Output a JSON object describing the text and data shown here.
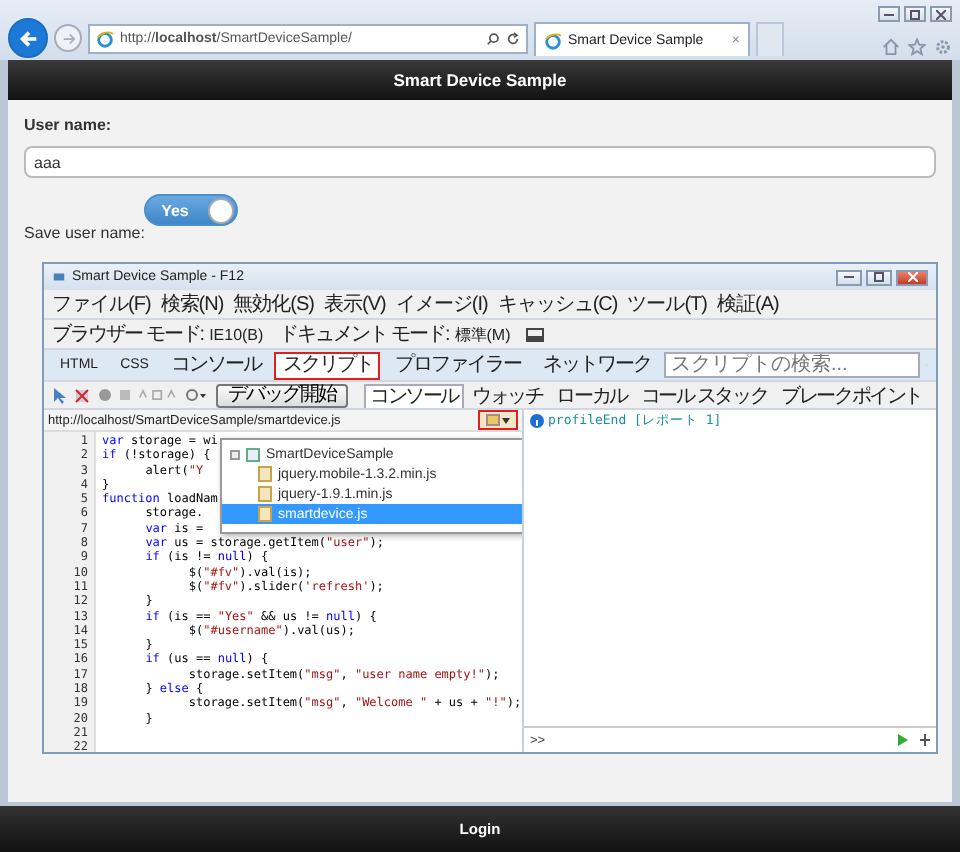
{
  "browser": {
    "address": "http://**localhost**/SmartDeviceSample/",
    "tab": {
      "title": "Smart Device Sample",
      "close": "×"
    }
  },
  "app": {
    "title": "Smart Device Sample",
    "footer_button": "Login"
  },
  "form": {
    "user_label": "User name:",
    "user_value": "aaa",
    "save_label": "Save user name:",
    "toggle": {
      "label": "Yes",
      "on": true
    }
  },
  "devtools": {
    "title": "Smart Device Sample - F12",
    "menu": [
      "ファイル(F)",
      "検索(N)",
      "無効化(S)",
      "表示(V)",
      "イメージ(I)",
      "キャッシュ(C)",
      "ツール(T)",
      "検証(A)"
    ],
    "modes": [
      {
        "label": "ブラウザー モード:",
        "value": "IE10(B)"
      },
      {
        "label": "ドキュメント モード:",
        "value": "標準(M)"
      }
    ],
    "tabs": [
      {
        "label": "HTML",
        "selected": false
      },
      {
        "label": "CSS",
        "selected": false
      },
      {
        "label": "コンソール",
        "selected": false
      },
      {
        "label": "スクリプト",
        "selected": true
      },
      {
        "label": "プロファイラー",
        "selected": false
      },
      {
        "label": "ネットワーク",
        "selected": false
      }
    ],
    "search": {
      "placeholder": "スクリプトの検索..."
    },
    "debug_button": "デバッグ開始",
    "side_tabs": [
      {
        "label": "コンソール",
        "selected": true
      },
      {
        "label": "ウォッチ",
        "selected": false
      },
      {
        "label": "ローカル",
        "selected": false
      },
      {
        "label": "コール スタック",
        "selected": false
      },
      {
        "label": "ブレークポイント",
        "selected": false
      }
    ],
    "file_path": "http://localhost/SmartDeviceSample/smartdevice.js",
    "code": [
      {
        "n": "1",
        "tokens": [
          {
            "kind": "kw",
            "t": "var"
          },
          {
            "kind": "plain",
            "t": " storage = wi"
          }
        ]
      },
      {
        "n": "2",
        "tokens": [
          {
            "kind": "kw",
            "t": "if"
          },
          {
            "kind": "plain",
            "t": " (!storage) {"
          }
        ]
      },
      {
        "n": "3",
        "tokens": [
          {
            "kind": "plain",
            "t": "\talert("
          },
          {
            "kind": "str",
            "t": "\"Y"
          }
        ]
      },
      {
        "n": "4",
        "tokens": [
          {
            "kind": "plain",
            "t": "}"
          }
        ]
      },
      {
        "n": "5",
        "tokens": [
          {
            "kind": "kw",
            "t": "function"
          },
          {
            "kind": "plain",
            "t": " loadNam"
          }
        ]
      },
      {
        "n": "6",
        "tokens": [
          {
            "kind": "plain",
            "t": "\tstorage."
          }
        ]
      },
      {
        "n": "7",
        "tokens": [
          {
            "kind": "kw",
            "t": "\tvar"
          },
          {
            "kind": "plain",
            "t": " is ="
          }
        ]
      },
      {
        "n": "8",
        "tokens": [
          {
            "kind": "kw",
            "t": "\tvar"
          },
          {
            "kind": "plain",
            "t": " us = storage.getItem("
          },
          {
            "kind": "str",
            "t": "\"user\""
          },
          {
            "kind": "plain",
            "t": ");"
          }
        ]
      },
      {
        "n": "9",
        "tokens": [
          {
            "kind": "kw",
            "t": "\tif"
          },
          {
            "kind": "plain",
            "t": " (is != "
          },
          {
            "kind": "kw",
            "t": "null"
          },
          {
            "kind": "plain",
            "t": ") {"
          }
        ]
      },
      {
        "n": "10",
        "tokens": [
          {
            "kind": "plain",
            "t": "\t\t$("
          },
          {
            "kind": "str",
            "t": "\"#fv\""
          },
          {
            "kind": "plain",
            "t": ").val(is);"
          }
        ]
      },
      {
        "n": "11",
        "tokens": [
          {
            "kind": "plain",
            "t": "\t\t$("
          },
          {
            "kind": "str",
            "t": "\"#fv\""
          },
          {
            "kind": "plain",
            "t": ").slider("
          },
          {
            "kind": "str",
            "t": "'refresh'"
          },
          {
            "kind": "plain",
            "t": ");"
          }
        ]
      },
      {
        "n": "12",
        "tokens": [
          {
            "kind": "plain",
            "t": "\t}"
          }
        ]
      },
      {
        "n": "13",
        "tokens": [
          {
            "kind": "kw",
            "t": "\tif"
          },
          {
            "kind": "plain",
            "t": " (is == "
          },
          {
            "kind": "str",
            "t": "\"Yes\""
          },
          {
            "kind": "plain",
            "t": " && us != "
          },
          {
            "kind": "kw",
            "t": "null"
          },
          {
            "kind": "plain",
            "t": ") {"
          }
        ]
      },
      {
        "n": "14",
        "tokens": [
          {
            "kind": "plain",
            "t": "\t\t$("
          },
          {
            "kind": "str",
            "t": "\"#username\""
          },
          {
            "kind": "plain",
            "t": ").val(us);"
          }
        ]
      },
      {
        "n": "15",
        "tokens": [
          {
            "kind": "plain",
            "t": "\t}"
          }
        ]
      },
      {
        "n": "16",
        "tokens": [
          {
            "kind": "kw",
            "t": "\tif"
          },
          {
            "kind": "plain",
            "t": " (us == "
          },
          {
            "kind": "kw",
            "t": "null"
          },
          {
            "kind": "plain",
            "t": ") {"
          }
        ]
      },
      {
        "n": "17",
        "tokens": [
          {
            "kind": "plain",
            "t": "\t\tstorage.setItem("
          },
          {
            "kind": "str",
            "t": "\"msg\""
          },
          {
            "kind": "plain",
            "t": ", "
          },
          {
            "kind": "str",
            "t": "\"user name empty!\""
          },
          {
            "kind": "plain",
            "t": ");"
          }
        ]
      },
      {
        "n": "18",
        "tokens": [
          {
            "kind": "plain",
            "t": "\t} "
          },
          {
            "kind": "kw",
            "t": "else"
          },
          {
            "kind": "plain",
            "t": " {"
          }
        ]
      },
      {
        "n": "19",
        "tokens": [
          {
            "kind": "plain",
            "t": "\t\tstorage.setItem("
          },
          {
            "kind": "str",
            "t": "\"msg\""
          },
          {
            "kind": "plain",
            "t": ", "
          },
          {
            "kind": "str",
            "t": "\"Welcome \""
          },
          {
            "kind": "plain",
            "t": " + us + "
          },
          {
            "kind": "str",
            "t": "\"!\""
          },
          {
            "kind": "plain",
            "t": ");"
          }
        ]
      },
      {
        "n": "20",
        "tokens": [
          {
            "kind": "plain",
            "t": "\t}"
          }
        ]
      },
      {
        "n": "21"
      },
      {
        "n": "22"
      }
    ],
    "file_popup": {
      "root": "SmartDeviceSample",
      "children": [
        {
          "name": "jquery.mobile-1.3.2.min.js",
          "selected": false
        },
        {
          "name": "jquery-1.9.1.min.js",
          "selected": false
        },
        {
          "name": "smartdevice.js",
          "selected": true
        }
      ]
    },
    "console": {
      "messages": [
        "profileEnd [レポート 1]"
      ],
      "prompt": ">>"
    }
  }
}
